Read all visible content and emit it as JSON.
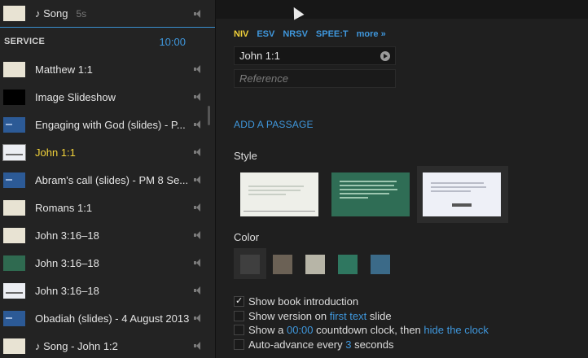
{
  "left": {
    "top_item": {
      "label": "♪ Song",
      "sub": "5s"
    },
    "service_heading": "SERVICE",
    "service_time": "10:00",
    "items": [
      {
        "label": "Matthew 1:1",
        "thumb": "paper"
      },
      {
        "label": "Image Slideshow",
        "thumb": "black"
      },
      {
        "label": "Engaging with God (slides) - P...",
        "thumb": "blue"
      },
      {
        "label": "John 1:1",
        "thumb": "white",
        "selected": true
      },
      {
        "label": "Abram's call (slides) - PM 8 Se...",
        "thumb": "blue"
      },
      {
        "label": "Romans 1:1",
        "thumb": "paper"
      },
      {
        "label": "John 3:16–18",
        "thumb": "paper"
      },
      {
        "label": "John 3:16–18",
        "thumb": "green"
      },
      {
        "label": "John 3:16–18",
        "thumb": "white"
      },
      {
        "label": "Obadiah (slides) - 4 August 2013",
        "thumb": "blue"
      },
      {
        "label": "♪ Song - John 1:2",
        "thumb": "paper"
      }
    ]
  },
  "right": {
    "versions": [
      "NIV",
      "ESV",
      "NRSV",
      "SPEE:T",
      "more »"
    ],
    "active_version": "NIV",
    "reference_value": "John 1:1",
    "reference_placeholder": "Reference",
    "add_passage": "ADD A PASSAGE",
    "style_label": "Style",
    "style_cards": [
      {
        "name": "light",
        "text": "For God so loved the world that He gave His only begotten Son"
      },
      {
        "name": "green",
        "text": "For God so loved the world that He gave His only begotten Son that whoever believes in Him should not perish but have everlasting life.",
        "ref": "John 3:16"
      },
      {
        "name": "bright",
        "text": "For God so loved the world that He gave His only begotten Son"
      }
    ],
    "color_label": "Color",
    "colors": [
      "#3f3f3f",
      "#6b6155",
      "#b7b5a7",
      "#2f7760",
      "#3b6a88"
    ],
    "options": {
      "o1": "Show book introduction",
      "o2a": "Show version on ",
      "o2_link": "first text",
      "o2b": " slide",
      "o3a": "Show a ",
      "o3_time": "00:00",
      "o3b": " countdown clock, then ",
      "o3_link": "hide the clock",
      "o4a": "Auto-advance every ",
      "o4_num": "3",
      "o4b": " seconds"
    }
  }
}
